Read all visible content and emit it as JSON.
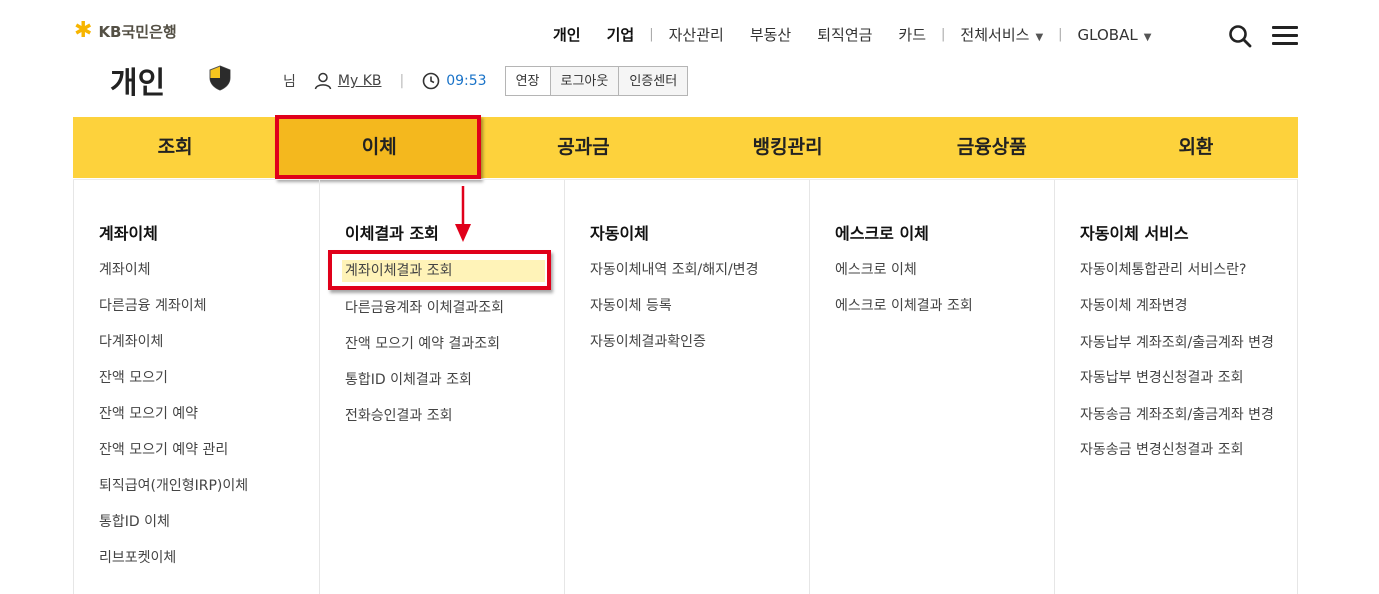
{
  "logo": {
    "text": "KB국민은행"
  },
  "topnav": {
    "items": [
      "개인",
      "기업",
      "자산관리",
      "부동산",
      "퇴직연금",
      "카드",
      "전체서비스",
      "GLOBAL"
    ]
  },
  "section": {
    "title": "개인",
    "greeting": "님",
    "mykb": "My KB",
    "time": "09:53",
    "buttons": [
      "연장",
      "로그아웃",
      "인증센터"
    ]
  },
  "mainnav": {
    "tabs": [
      "조회",
      "이체",
      "공과금",
      "뱅킹관리",
      "금융상품",
      "외환"
    ],
    "active_index": 1
  },
  "menu": {
    "columns": [
      {
        "title": "계좌이체",
        "items": [
          "계좌이체",
          "다른금융 계좌이체",
          "다계좌이체",
          "잔액 모으기",
          "잔액 모으기 예약",
          "잔액 모으기 예약 관리",
          "퇴직급여(개인형IRP)이체",
          "통합ID 이체",
          "리브포켓이체"
        ]
      },
      {
        "title": "이체결과 조회",
        "items": [
          "계좌이체결과 조회",
          "다른금융계좌 이체결과조회",
          "잔액 모으기 예약 결과조회",
          "통합ID 이체결과 조회",
          "전화승인결과 조회"
        ]
      },
      {
        "title": "자동이체",
        "items": [
          "자동이체내역 조회/해지/변경",
          "자동이체 등록",
          "자동이체결과확인증"
        ]
      },
      {
        "title": "에스크로 이체",
        "items": [
          "에스크로 이체",
          "에스크로 이체결과 조회"
        ]
      },
      {
        "title": "자동이체 서비스",
        "items": [
          "자동이체통합관리 서비스란?",
          "자동이체 계좌변경",
          "자동납부 계좌조회/출금계좌 변경",
          "자동납부 변경신청결과 조회",
          "자동송금 계좌조회/출금계좌 변경",
          "자동송금 변경신청결과 조회"
        ]
      }
    ]
  },
  "colors": {
    "nav_yellow": "#fdd23c",
    "nav_active": "#f4b81e",
    "highlight_red": "#e0001a",
    "time_blue": "#1a73c8"
  }
}
